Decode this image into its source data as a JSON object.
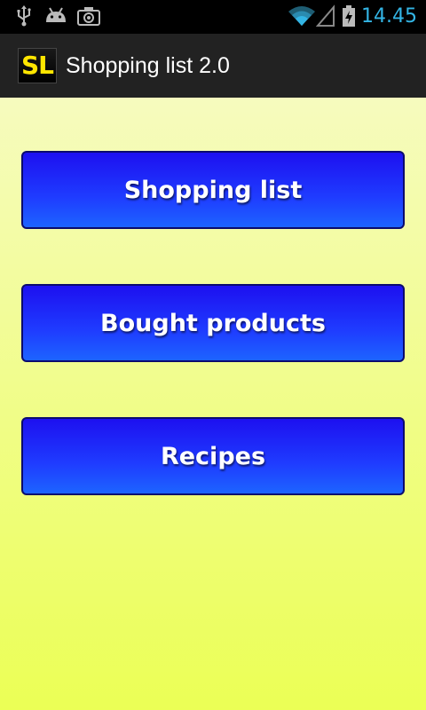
{
  "status_bar": {
    "time": "14.45",
    "icons": [
      "usb-icon",
      "android-debug-icon",
      "camera-icon",
      "wifi-icon",
      "signal-icon",
      "battery-charging-icon"
    ],
    "accent_color": "#33b5e5"
  },
  "action_bar": {
    "logo_text": "SL",
    "title": "Shopping list 2.0"
  },
  "menu": {
    "shopping_list_label": "Shopping list",
    "bought_products_label": "Bought products",
    "recipes_label": "Recipes"
  },
  "colors": {
    "button": "#1f3cff",
    "background_top": "#f6fbbe",
    "background_bottom": "#ebff55",
    "logo": "#ffe600"
  }
}
